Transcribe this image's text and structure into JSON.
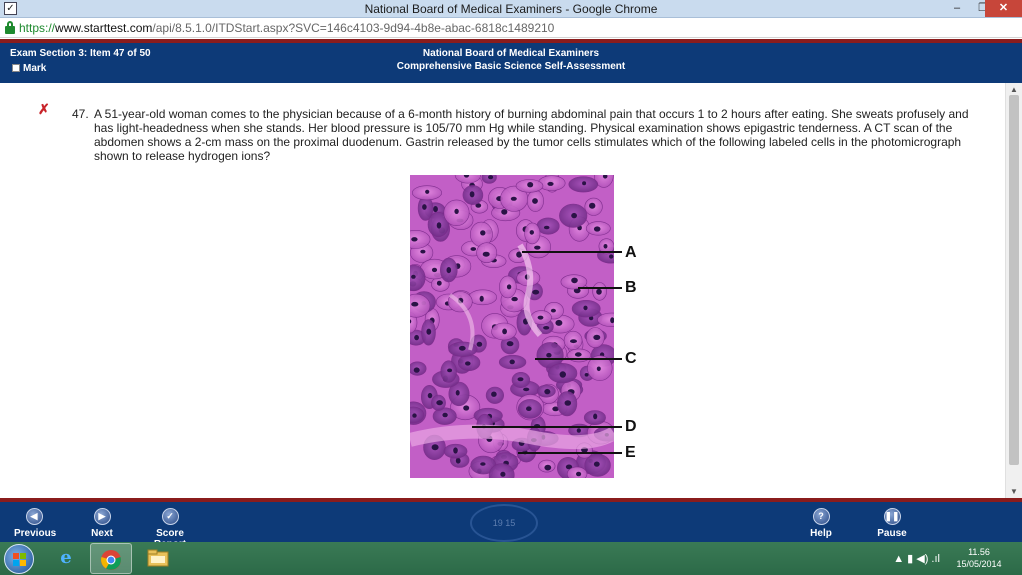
{
  "window": {
    "title": "National Board of Medical Examiners - Google Chrome",
    "controls": {
      "minimize": "–",
      "maximize": "❐",
      "close": "✕"
    }
  },
  "address_bar": {
    "scheme": "https://",
    "host": "www.starttest.com",
    "path": "/api/8.5.1.0/ITDStart.aspx?SVC=146c4103-9d94-4b8e-abac-6818c1489210"
  },
  "exam_header": {
    "section": "Exam Section 3: Item 47 of 50",
    "mark_label": "Mark",
    "organization": "National Board of Medical Examiners",
    "subtitle": "Comprehensive Basic Science Self-Assessment"
  },
  "question": {
    "number": "47.",
    "strike_icon": "✗",
    "text": "A 51-year-old woman comes to the physician because of a 6-month history of burning abdominal pain that occurs 1 to 2 hours after eating. She sweats profusely and has light-headedness when she stands. Her blood pressure is 105/70 mm Hg while standing. Physical examination shows epigastric tenderness. A CT scan of the abdomen shows a 2-cm mass on the proximal duodenum. Gastrin released by the tumor cells stimulates which of the following labeled cells in the photomicrograph shown to release hydrogen ions?",
    "image_labels": [
      "A",
      "B",
      "C",
      "D",
      "E"
    ]
  },
  "navigation": {
    "previous": "Previous",
    "next": "Next",
    "score_report": "Score Report",
    "help": "Help",
    "pause": "Pause",
    "seal_text": "19   15"
  },
  "taskbar": {
    "time": "11.56",
    "date": "15/05/2014",
    "tray_icons": "▲  ▮  ◀)  .ıl"
  },
  "colors": {
    "header_blue": "#0d3a78",
    "header_border": "#8a1c1c",
    "tissue_pink": "#d46ad6",
    "tissue_purple": "#8e3a9e",
    "strike_red": "#c8242a"
  }
}
